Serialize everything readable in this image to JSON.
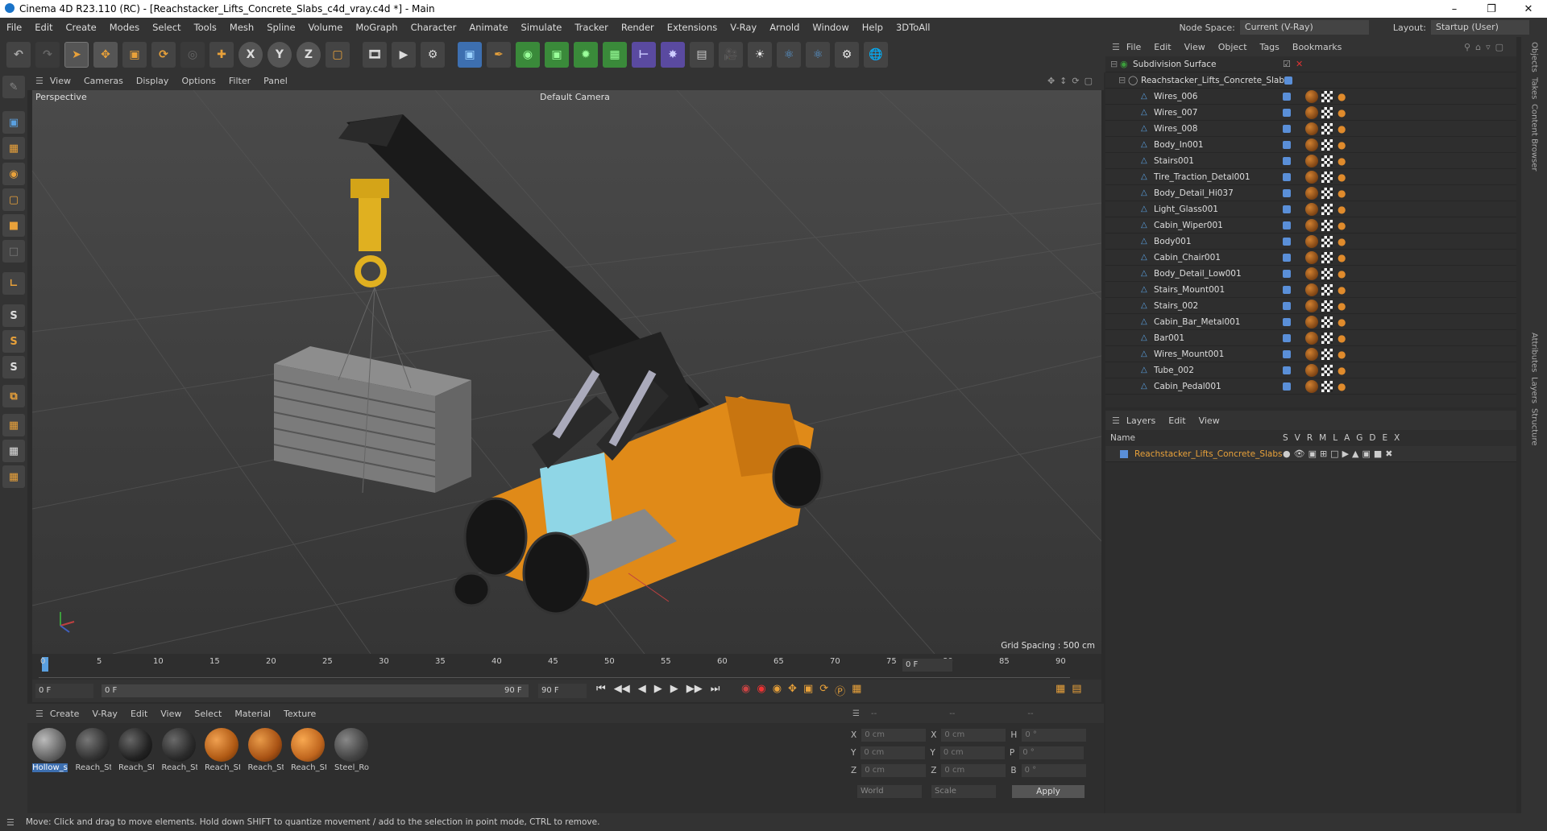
{
  "window": {
    "title": "Cinema 4D R23.110 (RC) - [Reachstacker_Lifts_Concrete_Slabs_c4d_vray.c4d *] - Main",
    "node_space_label": "Node Space:",
    "node_space_value": "Current (V-Ray)",
    "layout_label": "Layout:",
    "layout_value": "Startup (User)"
  },
  "menu": [
    "File",
    "Edit",
    "Create",
    "Modes",
    "Select",
    "Tools",
    "Mesh",
    "Spline",
    "Volume",
    "MoGraph",
    "Character",
    "Animate",
    "Simulate",
    "Tracker",
    "Render",
    "Extensions",
    "V-Ray",
    "Arnold",
    "Window",
    "Help",
    "3DToAll"
  ],
  "toolbar": {
    "axis_x": "X",
    "axis_y": "Y",
    "axis_z": "Z"
  },
  "viewport": {
    "menu": [
      "View",
      "Cameras",
      "Display",
      "Options",
      "Filter",
      "Panel"
    ],
    "label": "Perspective",
    "camera": "Default Camera",
    "grid_spacing": "Grid Spacing : 500 cm"
  },
  "timeline": {
    "ticks": [
      "0",
      "5",
      "10",
      "15",
      "20",
      "25",
      "30",
      "35",
      "40",
      "45",
      "50",
      "55",
      "60",
      "65",
      "70",
      "75",
      "80",
      "85",
      "90"
    ],
    "current_frame": "0 F",
    "start_frame": "0 F",
    "range_start": "0 F",
    "range_end": "90 F",
    "end_frame": "90 F"
  },
  "materials": {
    "menu": [
      "Create",
      "V-Ray",
      "Edit",
      "View",
      "Select",
      "Material",
      "Texture"
    ],
    "items": [
      {
        "label": "Hollow_s",
        "color": "#8a8a8a"
      },
      {
        "label": "Reach_St",
        "color": "#3a3a3a"
      },
      {
        "label": "Reach_St",
        "color": "#2a2a2a"
      },
      {
        "label": "Reach_St",
        "color": "#333333"
      },
      {
        "label": "Reach_St",
        "color": "#c0661e"
      },
      {
        "label": "Reach_St",
        "color": "#b35a18"
      },
      {
        "label": "Reach_St",
        "color": "#d07020"
      },
      {
        "label": "Steel_Ro",
        "color": "#555555"
      }
    ]
  },
  "coords": {
    "header": [
      "--",
      "--",
      "--"
    ],
    "rows": [
      {
        "a": "X",
        "av": "0 cm",
        "b": "X",
        "bv": "0 cm",
        "c": "H",
        "cv": "0 °"
      },
      {
        "a": "Y",
        "av": "0 cm",
        "b": "Y",
        "bv": "0 cm",
        "c": "P",
        "cv": "0 °"
      },
      {
        "a": "Z",
        "av": "0 cm",
        "b": "Z",
        "bv": "0 cm",
        "c": "B",
        "cv": "0 °"
      }
    ],
    "world": "World",
    "scale": "Scale",
    "apply": "Apply"
  },
  "status": "Move: Click and drag to move elements. Hold down SHIFT to quantize movement / add to the selection in point mode, CTRL to remove.",
  "objects": {
    "menu": [
      "File",
      "Edit",
      "View",
      "Object",
      "Tags",
      "Bookmarks"
    ],
    "root": "Subdivision Surface",
    "group": "Reachstacker_Lifts_Concrete_Slabs",
    "items": [
      "Wires_006",
      "Wires_007",
      "Wires_008",
      "Body_In001",
      "Stairs001",
      "Tire_Traction_Detal001",
      "Body_Detail_Hi037",
      "Light_Glass001",
      "Cabin_Wiper001",
      "Body001",
      "Cabin_Chair001",
      "Body_Detail_Low001",
      "Stairs_Mount001",
      "Stairs_002",
      "Cabin_Bar_Metal001",
      "Bar001",
      "Wires_Mount001",
      "Tube_002",
      "Cabin_Pedal001"
    ]
  },
  "layers": {
    "menu": [
      "Layers",
      "Edit",
      "View"
    ],
    "name_header": "Name",
    "columns": [
      "S",
      "V",
      "R",
      "M",
      "L",
      "A",
      "G",
      "D",
      "E",
      "X"
    ],
    "item": "Reachstacker_Lifts_Concrete_Slabs"
  },
  "side_tabs": [
    "Objects",
    "Takes",
    "Content Browser",
    "Attributes",
    "Layers",
    "Structure"
  ]
}
